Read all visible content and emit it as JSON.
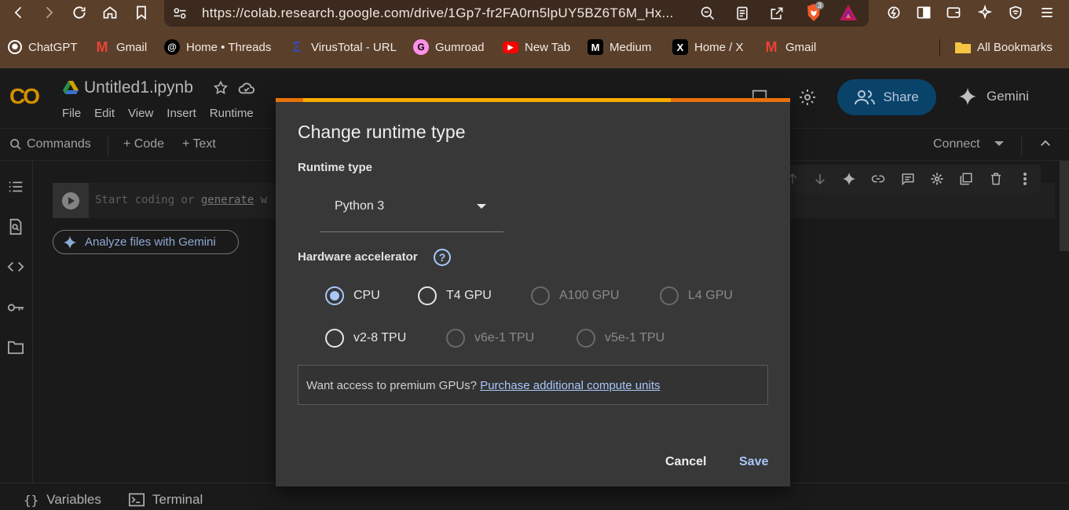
{
  "browser": {
    "url": "https://colab.research.google.com/drive/1Gp7-fr2FA0rn5lpUY5BZ6T6M_Hx...",
    "brave_badge_count": "3",
    "bookmarks": [
      {
        "label": "ChatGPT",
        "icon": "chatgpt-icon"
      },
      {
        "label": "Gmail",
        "icon": "gmail-icon"
      },
      {
        "label": "Home • Threads",
        "icon": "threads-icon"
      },
      {
        "label": "VirusTotal - URL",
        "icon": "virustotal-icon"
      },
      {
        "label": "Gumroad",
        "icon": "gumroad-icon"
      },
      {
        "label": "New Tab",
        "icon": "youtube-icon"
      },
      {
        "label": "Medium",
        "icon": "medium-icon"
      },
      {
        "label": "Home / X",
        "icon": "x-icon"
      },
      {
        "label": "Gmail",
        "icon": "gmail-icon"
      }
    ],
    "all_bookmarks": "All Bookmarks"
  },
  "colab": {
    "logo": "CO",
    "notebook_title": "Untitled1.ipynb",
    "menu": [
      "File",
      "Edit",
      "View",
      "Insert",
      "Runtime"
    ],
    "share_label": "Share",
    "gemini_label": "Gemini",
    "toolbar": {
      "commands": "Commands",
      "code": "+ Code",
      "text": "+ Text",
      "connect": "Connect"
    },
    "cell_placeholder_start": "Start coding or ",
    "cell_placeholder_link": "generate",
    "cell_placeholder_end": " w",
    "analyze_label": "Analyze files with Gemini",
    "status": {
      "variables": "Variables",
      "terminal": "Terminal"
    }
  },
  "dialog": {
    "title": "Change runtime type",
    "runtime_label": "Runtime type",
    "runtime_value": "Python 3",
    "accelerator_label": "Hardware accelerator",
    "loading_progress": 0.78,
    "options": [
      {
        "label": "CPU",
        "checked": true,
        "enabled": true
      },
      {
        "label": "T4 GPU",
        "checked": false,
        "enabled": true
      },
      {
        "label": "A100 GPU",
        "checked": false,
        "enabled": false
      },
      {
        "label": "L4 GPU",
        "checked": false,
        "enabled": false
      },
      {
        "label": "v2-8 TPU",
        "checked": false,
        "enabled": true
      },
      {
        "label": "v6e-1 TPU",
        "checked": false,
        "enabled": false
      },
      {
        "label": "v5e-1 TPU",
        "checked": false,
        "enabled": false
      }
    ],
    "promo_text": "Want access to premium GPUs? ",
    "promo_link": "Purchase additional compute units",
    "cancel": "Cancel",
    "save": "Save"
  }
}
